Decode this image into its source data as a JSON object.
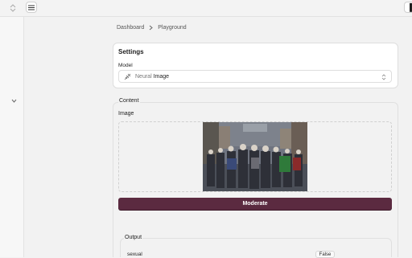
{
  "breadcrumb": {
    "items": [
      "Dashboard",
      "Playground"
    ]
  },
  "settings": {
    "title": "Settings",
    "model_label": "Model",
    "model_prefix": "Neural",
    "model_value": "Image"
  },
  "content": {
    "legend": "Content",
    "image_label": "Image"
  },
  "actions": {
    "moderate_label": "Moderate"
  },
  "output": {
    "legend": "Output",
    "rows": [
      {
        "label": "sexual",
        "value": "False"
      }
    ]
  },
  "colors": {
    "accent": "#5b2a40"
  },
  "icons": [
    "sort-icon",
    "menu-icon",
    "chevron-down-icon",
    "model-icon",
    "select-arrows-icon",
    "chevron-right-icon"
  ]
}
